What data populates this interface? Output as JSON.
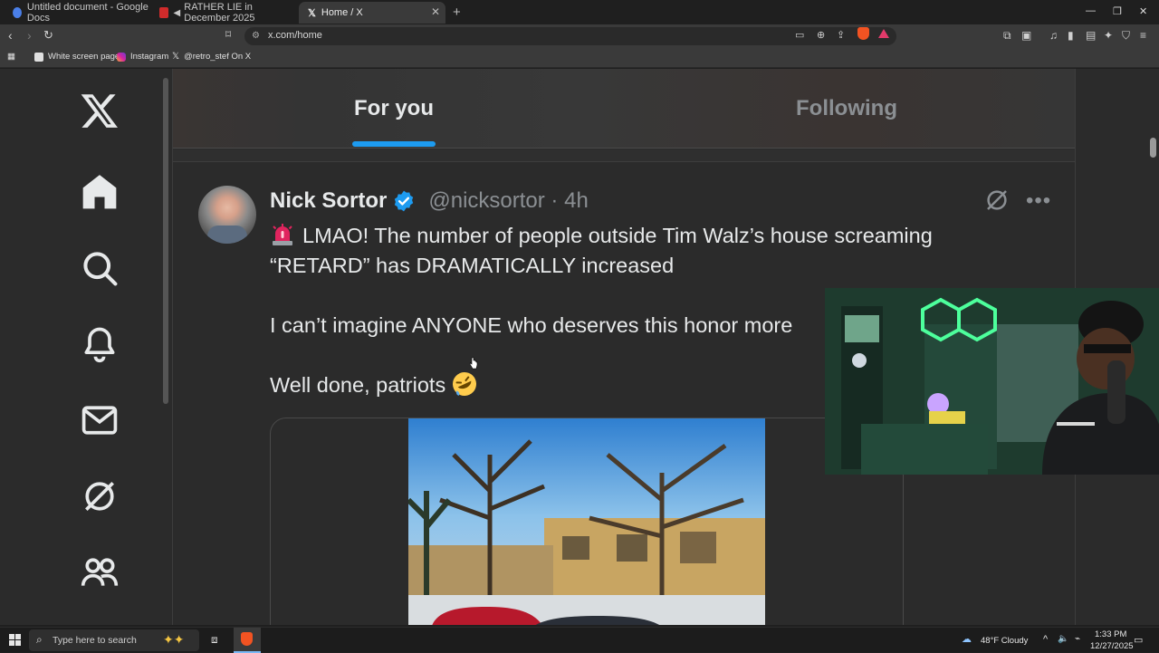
{
  "browser": {
    "tabs": [
      {
        "title": "Untitled document - Google Docs",
        "active": false,
        "favicon_color": "#4a7fe8"
      },
      {
        "title": "RATHER LIE in December 2025",
        "active": false,
        "favicon_color": "#d12b2b"
      },
      {
        "title": "Home / X",
        "active": true,
        "favicon_color": "#e7e9ea"
      }
    ],
    "new_tab_symbol": "+",
    "url": "x.com/home",
    "bookmarks": [
      "White screen page",
      "Instagram",
      "@retro_stef On X"
    ]
  },
  "x_nav": {
    "items": [
      "x-logo",
      "home",
      "explore",
      "notifications",
      "messages",
      "grok",
      "communities"
    ]
  },
  "feed": {
    "tabs": [
      {
        "label": "For you",
        "selected": true
      },
      {
        "label": "Following",
        "selected": false
      }
    ],
    "accent": "#1d9bf0"
  },
  "post": {
    "author_name": "Nick Sortor",
    "handle_time": "@nicksortor · 4h",
    "line1": "LMAO! The number of people outside Tim Walz’s house screaming",
    "line2": "“RETARD” has DRAMATICALLY increased",
    "line3": "I can’t imagine ANYONE who deserves this honor more",
    "line4": "Well done, patriots",
    "verified_color": "#1d9bf0",
    "more_symbol": "•••"
  },
  "taskbar": {
    "search_placeholder": "Type here to search",
    "weather": "48°F  Cloudy",
    "time": "1:33 PM",
    "date": "12/27/2025"
  }
}
